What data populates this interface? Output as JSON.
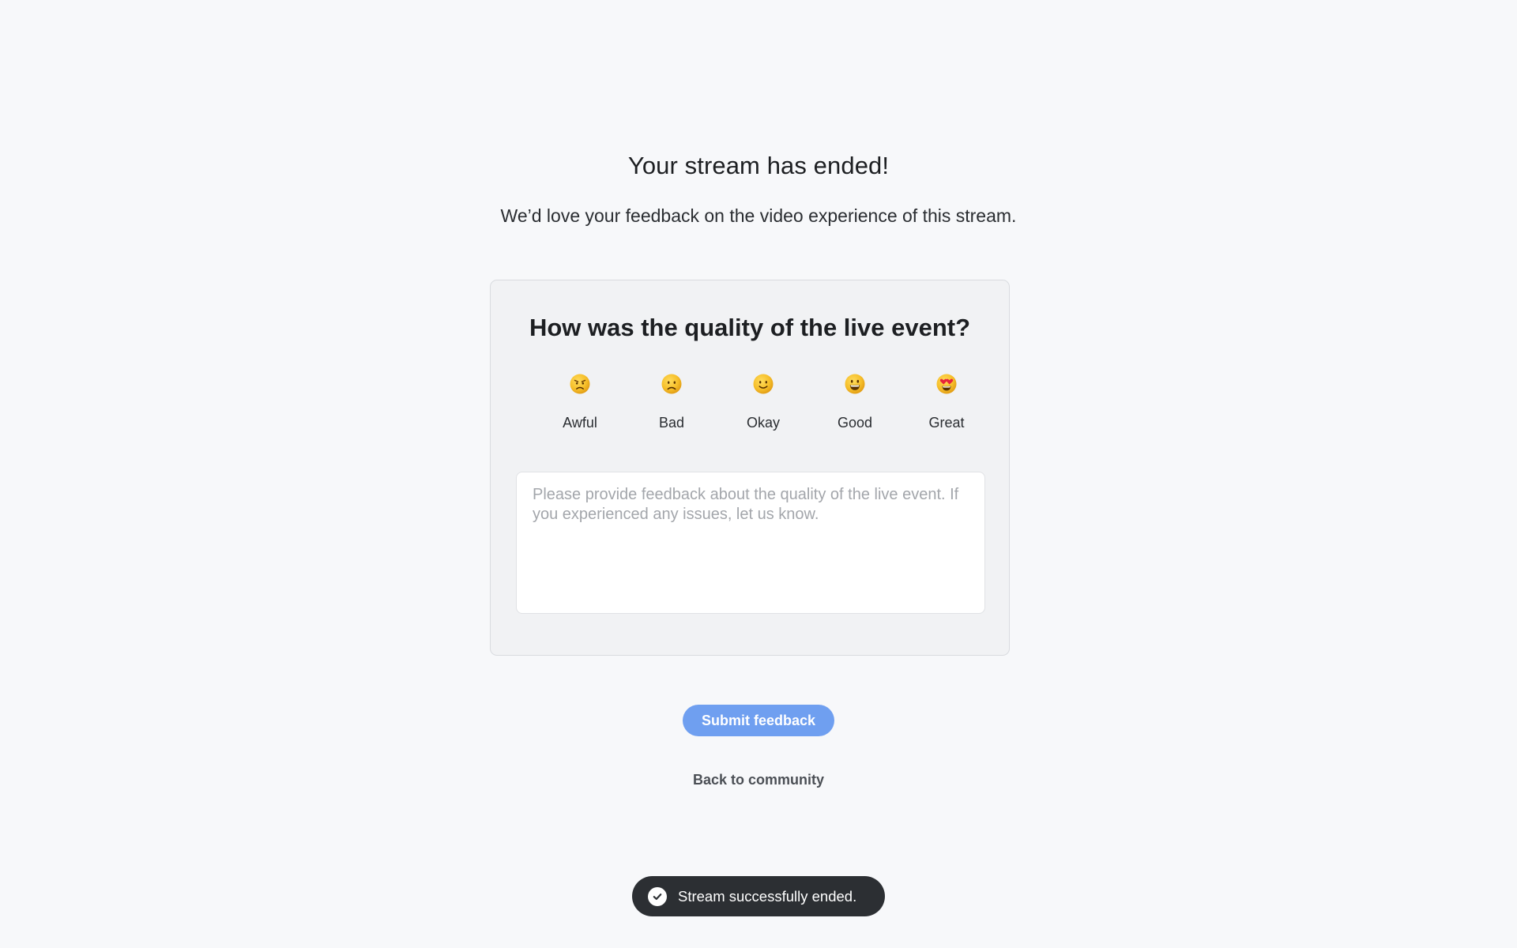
{
  "header": {
    "title": "Your stream has ended!",
    "subtitle": "We’d love your feedback on the video experience of this stream."
  },
  "feedback_card": {
    "question": "How was the quality of the live event?",
    "ratings": [
      {
        "label": "Awful",
        "icon": "angry-face-icon"
      },
      {
        "label": "Bad",
        "icon": "frowning-face-icon"
      },
      {
        "label": "Okay",
        "icon": "slightly-smiling-face-icon"
      },
      {
        "label": "Good",
        "icon": "grinning-face-icon"
      },
      {
        "label": "Great",
        "icon": "heart-eyes-face-icon"
      }
    ],
    "textarea": {
      "value": "",
      "placeholder": "Please provide feedback about the quality of the live event. If you experienced any issues, let us know."
    }
  },
  "actions": {
    "submit_label": "Submit feedback",
    "back_label": "Back to community"
  },
  "toast": {
    "message": "Stream successfully ended.",
    "icon": "check-circle-icon"
  },
  "colors": {
    "background": "#f7f8fa",
    "card": "#f1f2f4",
    "accent": "#6f9ff0",
    "toast": "#2c2f33"
  }
}
